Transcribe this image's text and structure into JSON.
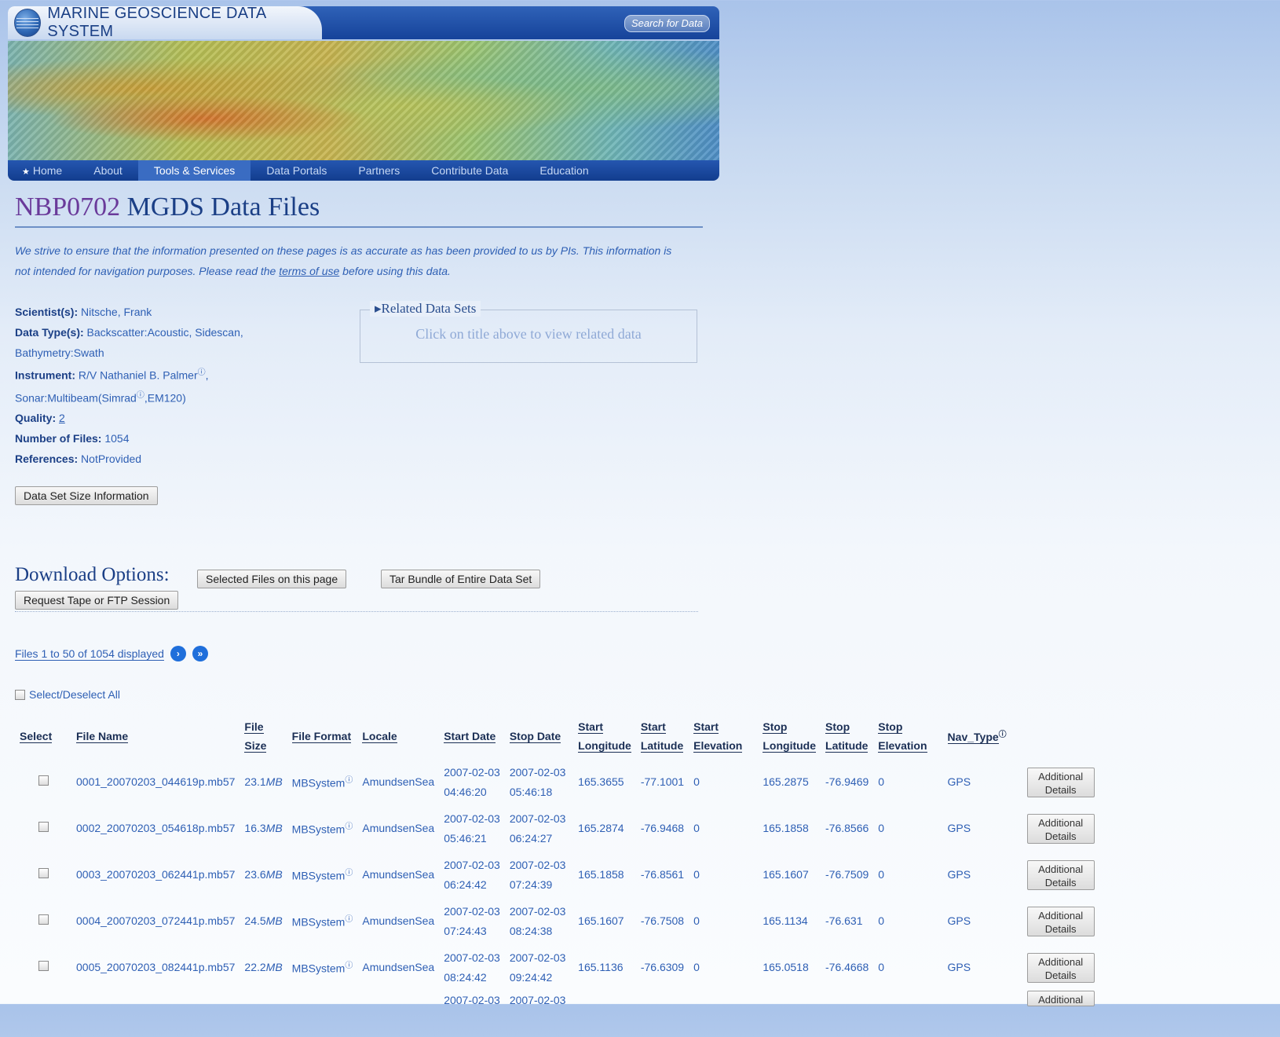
{
  "header": {
    "site_title": "MARINE GEOSCIENCE DATA SYSTEM",
    "search_label": "Search for Data"
  },
  "nav": {
    "items": [
      "Home",
      "About",
      "Tools & Services",
      "Data Portals",
      "Partners",
      "Contribute Data",
      "Education"
    ],
    "active": "Tools & Services"
  },
  "page": {
    "cruise_id": "NBP0702",
    "title_rest": " MGDS Data Files",
    "disclaimer_1": "We strive to ensure that the information presented on these pages is as accurate as has been provided to us by PIs. This information is not intended for navigation purposes. Please read the ",
    "disclaimer_link": "terms of use",
    "disclaimer_2": " before using this data."
  },
  "meta": {
    "scientist_label": "Scientist(s):",
    "scientist": " Nitsche, Frank",
    "datatype_label": "Data Type(s):",
    "datatype": " Backscatter:Acoustic, Sidescan, Bathymetry:Swath",
    "instrument_label": "Instrument:",
    "instrument_1": " R/V Nathaniel B. Palmer",
    "instrument_2": ", Sonar:Multibeam(Simrad",
    "instrument_3": ",EM120)",
    "quality_label": "Quality:",
    "quality": "2",
    "numfiles_label": "Number of Files:",
    "numfiles": " 1054",
    "references_label": "References:",
    "references": " NotProvided",
    "info_glyph": "ⓘ"
  },
  "related": {
    "legend": "▸Related Data Sets",
    "text": "Click on title above to view related data"
  },
  "buttons": {
    "size_info": "Data Set Size Information",
    "selected_files": "Selected Files on this page",
    "tar_bundle": "Tar Bundle of Entire Data Set",
    "request_tape": "Request Tape or FTP Session"
  },
  "download_title": "Download Options:",
  "files_count": "Files 1 to 50 of 1054 displayed",
  "select_all": "Select/Deselect All",
  "table": {
    "headers": {
      "select": "Select",
      "file_name": "File Name",
      "file_size_1": "File",
      "file_size_2": "Size",
      "file_format": "File Format",
      "locale": "Locale",
      "start_date": "Start Date",
      "stop_date": "Stop Date",
      "start_lon_1": "Start",
      "start_lon_2": "Longitude",
      "start_lat_1": "Start",
      "start_lat_2": "Latitude",
      "start_elev_1": "Start",
      "start_elev_2": "Elevation",
      "stop_lon_1": "Stop",
      "stop_lon_2": "Longitude",
      "stop_lat_1": "Stop",
      "stop_lat_2": "Latitude",
      "stop_elev_1": "Stop",
      "stop_elev_2": "Elevation",
      "nav_type": "Nav_Type"
    },
    "details_label_1": "Additional",
    "details_label_2": "Details",
    "rows": [
      {
        "name": "0001_20070203_044619p.mb57",
        "size": "23.1",
        "unit": "MB",
        "format": "MBSystem",
        "locale": "AmundsenSea",
        "start_d": "2007-02-03",
        "start_t": "04:46:20",
        "stop_d": "2007-02-03",
        "stop_t": "05:46:18",
        "start_lon": "165.3655",
        "start_lat": "-77.1001",
        "start_elev": "0",
        "stop_lon": "165.2875",
        "stop_lat": "-76.9469",
        "stop_elev": "0",
        "nav": "GPS"
      },
      {
        "name": "0002_20070203_054618p.mb57",
        "size": "16.3",
        "unit": "MB",
        "format": "MBSystem",
        "locale": "AmundsenSea",
        "start_d": "2007-02-03",
        "start_t": "05:46:21",
        "stop_d": "2007-02-03",
        "stop_t": "06:24:27",
        "start_lon": "165.2874",
        "start_lat": "-76.9468",
        "start_elev": "0",
        "stop_lon": "165.1858",
        "stop_lat": "-76.8566",
        "stop_elev": "0",
        "nav": "GPS"
      },
      {
        "name": "0003_20070203_062441p.mb57",
        "size": "23.6",
        "unit": "MB",
        "format": "MBSystem",
        "locale": "AmundsenSea",
        "start_d": "2007-02-03",
        "start_t": "06:24:42",
        "stop_d": "2007-02-03",
        "stop_t": "07:24:39",
        "start_lon": "165.1858",
        "start_lat": "-76.8561",
        "start_elev": "0",
        "stop_lon": "165.1607",
        "stop_lat": "-76.7509",
        "stop_elev": "0",
        "nav": "GPS"
      },
      {
        "name": "0004_20070203_072441p.mb57",
        "size": "24.5",
        "unit": "MB",
        "format": "MBSystem",
        "locale": "AmundsenSea",
        "start_d": "2007-02-03",
        "start_t": "07:24:43",
        "stop_d": "2007-02-03",
        "stop_t": "08:24:38",
        "start_lon": "165.1607",
        "start_lat": "-76.7508",
        "start_elev": "0",
        "stop_lon": "165.1134",
        "stop_lat": "-76.631",
        "stop_elev": "0",
        "nav": "GPS"
      },
      {
        "name": "0005_20070203_082441p.mb57",
        "size": "22.2",
        "unit": "MB",
        "format": "MBSystem",
        "locale": "AmundsenSea",
        "start_d": "2007-02-03",
        "start_t": "08:24:42",
        "stop_d": "2007-02-03",
        "stop_t": "09:24:42",
        "start_lon": "165.1136",
        "start_lat": "-76.6309",
        "start_elev": "0",
        "stop_lon": "165.0518",
        "stop_lat": "-76.4668",
        "stop_elev": "0",
        "nav": "GPS"
      }
    ],
    "partial_row": {
      "start_d": "2007-02-03",
      "stop_d": "2007-02-03",
      "details": "Additional"
    }
  }
}
